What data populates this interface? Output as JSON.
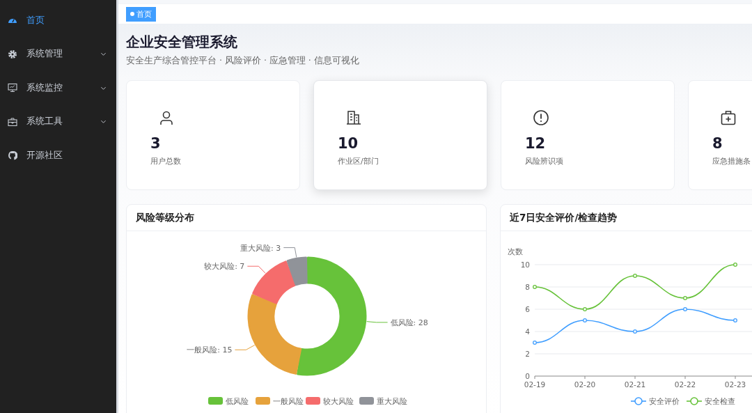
{
  "sidebar": {
    "items": [
      {
        "label": "首页",
        "kind": "link",
        "selected": true
      },
      {
        "label": "系统管理",
        "kind": "submenu",
        "selected": false
      },
      {
        "label": "系统监控",
        "kind": "submenu",
        "selected": false
      },
      {
        "label": "系统工具",
        "kind": "submenu",
        "selected": false
      },
      {
        "label": "开源社区",
        "kind": "link",
        "selected": false
      }
    ]
  },
  "tags": [
    {
      "label": "首页",
      "selected": true
    }
  ],
  "header": {
    "title": "企业安全管理系统",
    "subtitle": "安全生产综合管控平台 · 风险评价 · 应急管理 · 信息可视化"
  },
  "stats": [
    {
      "value": "3",
      "label": "用户总数",
      "raised": false
    },
    {
      "value": "10",
      "label": "作业区/部门",
      "raised": true
    },
    {
      "value": "12",
      "label": "风险辨识项",
      "raised": false
    },
    {
      "value": "8",
      "label": "应急措施条",
      "raised": false
    }
  ],
  "panels": [
    {
      "title": "风险等级分布",
      "chart_data": {
        "type": "donut",
        "categories": [
          "低风险",
          "一般风险",
          "较大风险",
          "重大风险"
        ],
        "values": [
          28,
          15,
          7,
          3
        ],
        "legend": true,
        "colors": [
          "#67c23a",
          "#e6a23c",
          "#f56c6c",
          "#909399"
        ],
        "value_labels": [
          "低风险: 28",
          "一般风险: 15",
          "较大风险: 7",
          "重大风险: 3"
        ]
      }
    },
    {
      "title": "近7日安全评价/检查趋势",
      "chart_data": {
        "type": "line",
        "ylabel": "次数",
        "categories": [
          "02-19",
          "02-20",
          "02-21",
          "02-22",
          "02-23"
        ],
        "ylim": [
          0,
          10
        ],
        "yticks": [
          {
            "value": 0,
            "label": "0"
          },
          {
            "value": 2,
            "label": "2"
          },
          {
            "value": 4,
            "label": "4"
          },
          {
            "value": 6,
            "label": "6"
          },
          {
            "value": 8,
            "label": "8"
          },
          {
            "value": 10,
            "label": "10"
          }
        ],
        "grid": true,
        "legend": true,
        "series": [
          {
            "name": "安全评价",
            "color": "#409eff",
            "marker": "circle",
            "values": [
              3,
              5,
              4,
              6,
              5
            ]
          },
          {
            "name": "安全检查",
            "color": "#67c23a",
            "marker": "circle",
            "values": [
              8,
              6,
              9,
              7,
              10
            ]
          }
        ]
      }
    }
  ]
}
